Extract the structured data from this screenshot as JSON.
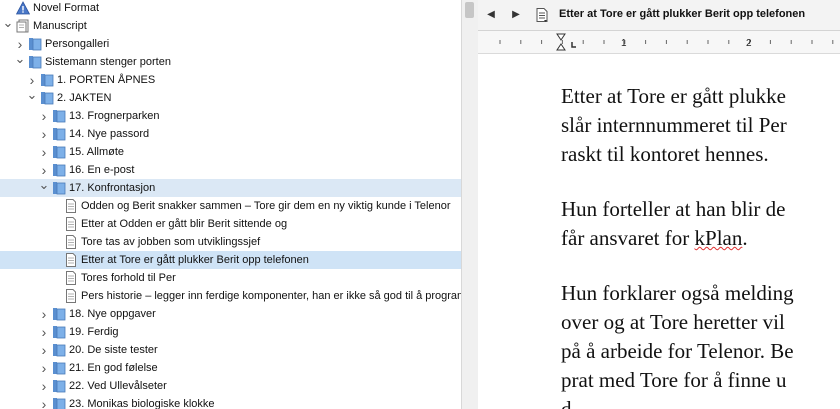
{
  "binder": {
    "items": [
      {
        "label": "Novel Format",
        "level": 0,
        "icon": "warning-icon",
        "chevron": "none",
        "selected": false
      },
      {
        "label": "Manuscript",
        "level": 0,
        "icon": "manuscript-icon",
        "chevron": "open",
        "selected": false
      },
      {
        "label": "Persongalleri",
        "level": 1,
        "icon": "folder-icon",
        "chevron": "closed",
        "selected": false
      },
      {
        "label": "Sistemann stenger porten",
        "level": 1,
        "icon": "folder-icon",
        "chevron": "open",
        "selected": false
      },
      {
        "label": "1. PORTEN ÅPNES",
        "level": 2,
        "icon": "folder-icon",
        "chevron": "closed",
        "selected": false
      },
      {
        "label": "2. JAKTEN",
        "level": 2,
        "icon": "folder-icon",
        "chevron": "open",
        "selected": false
      },
      {
        "label": "13. Frognerparken",
        "level": 3,
        "icon": "folder-icon",
        "chevron": "closed",
        "selected": false
      },
      {
        "label": "14. Nye passord",
        "level": 3,
        "icon": "folder-icon",
        "chevron": "closed",
        "selected": false
      },
      {
        "label": "15. Allmøte",
        "level": 3,
        "icon": "folder-icon",
        "chevron": "closed",
        "selected": false
      },
      {
        "label": "16. En e-post",
        "level": 3,
        "icon": "folder-icon",
        "chevron": "closed",
        "selected": false
      },
      {
        "label": "17. Konfrontasjon",
        "level": 3,
        "icon": "folder-icon",
        "chevron": "open",
        "selected": "parent"
      },
      {
        "label": "Odden og Berit snakker sammen – Tore gir dem en ny viktig kunde i Telenor",
        "level": 4,
        "icon": "document-icon",
        "chevron": "none",
        "selected": false
      },
      {
        "label": "Etter at Odden er gått blir Berit sittende og",
        "level": 4,
        "icon": "document-icon",
        "chevron": "none",
        "selected": false
      },
      {
        "label": "Tore tas av jobben som utviklingssjef",
        "level": 4,
        "icon": "document-icon",
        "chevron": "none",
        "selected": false
      },
      {
        "label": "Etter at Tore er gått plukker Berit opp telefonen",
        "level": 4,
        "icon": "document-icon",
        "chevron": "none",
        "selected": true
      },
      {
        "label": "Tores forhold til Per",
        "level": 4,
        "icon": "document-icon",
        "chevron": "none",
        "selected": false
      },
      {
        "label": "Pers historie – legger inn ferdige komponenter, han er ikke så god til å program...",
        "level": 4,
        "icon": "document-icon",
        "chevron": "none",
        "selected": false
      },
      {
        "label": "18. Nye oppgaver",
        "level": 3,
        "icon": "folder-icon",
        "chevron": "closed",
        "selected": false
      },
      {
        "label": "19. Ferdig",
        "level": 3,
        "icon": "folder-icon",
        "chevron": "closed",
        "selected": false
      },
      {
        "label": "20. De siste tester",
        "level": 3,
        "icon": "folder-icon",
        "chevron": "closed",
        "selected": false
      },
      {
        "label": "21. En god følelse",
        "level": 3,
        "icon": "folder-icon",
        "chevron": "closed",
        "selected": false
      },
      {
        "label": "22. Ved Ullevålseter",
        "level": 3,
        "icon": "folder-icon",
        "chevron": "closed",
        "selected": false
      },
      {
        "label": "23. Monikas biologiske klokke",
        "level": 3,
        "icon": "folder-icon",
        "chevron": "closed",
        "selected": false
      }
    ]
  },
  "editor": {
    "back_glyph": "◀",
    "forward_glyph": "▶",
    "doc_title": "Etter at Tore er gått plukker Berit opp telefonen",
    "ruler": {
      "numbers": [
        "1",
        "2"
      ]
    },
    "paragraphs": [
      {
        "lines": [
          "Etter at Tore er gått plukke",
          "slår internnummeret til Per",
          "raskt til kontoret hennes."
        ]
      },
      {
        "lines": [
          "Hun forteller at han blir de"
        ],
        "line2_pre": "får ansvaret for ",
        "line2_sq": "kPlan",
        "line2_post": "."
      },
      {
        "lines": [
          "Hun forklarer også melding",
          "over og at Tore heretter vil",
          "på å arbeide for Telenor. Be",
          "prat med Tore for å finne u",
          "d"
        ]
      }
    ]
  }
}
